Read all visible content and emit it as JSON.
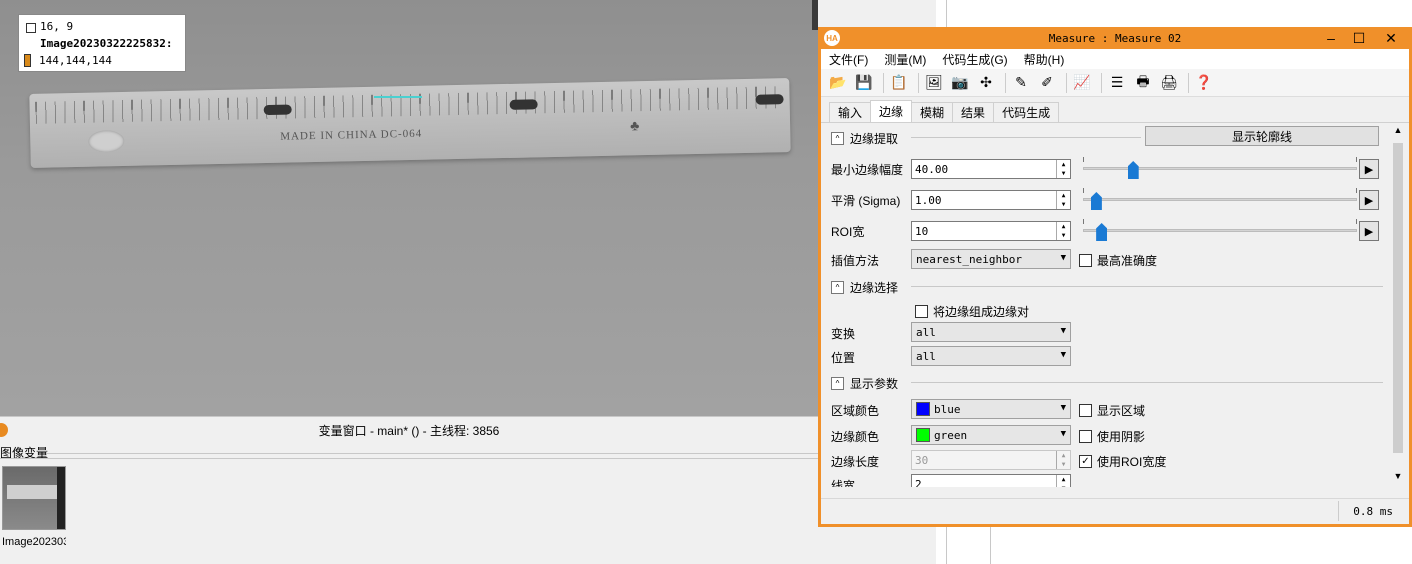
{
  "graphics": {
    "info_coords": "16, 9",
    "info_image_name": "Image20230322225832:",
    "info_gray_values": "144,144,144",
    "ruler_imprint": "MADE IN CHINA  DC-064"
  },
  "variable_window": {
    "title": "变量窗口 - main* () - 主线程: 3856",
    "group_label": "图像变量",
    "thumbnail_label": "Image202303"
  },
  "dialog": {
    "title": "Measure : Measure 02",
    "menu": [
      "文件(F)",
      "测量(M)",
      "代码生成(G)",
      "帮助(H)"
    ],
    "tabs": [
      "输入",
      "边缘",
      "模糊",
      "结果",
      "代码生成"
    ],
    "active_tab": "边缘",
    "edge_extraction": {
      "section_title": "边缘提取",
      "show_contour_button": "显示轮廓线",
      "min_amplitude_label": "最小边缘幅度",
      "min_amplitude_value": "40.00",
      "min_amplitude_slider": 0.17,
      "sigma_label": "平滑 (Sigma)",
      "sigma_value": "1.00",
      "sigma_slider": 0.03,
      "roi_width_label": "ROI宽",
      "roi_width_value": "10",
      "roi_width_slider": 0.05,
      "interpolation_label": "插值方法",
      "interpolation_value": "nearest_neighbor",
      "highest_accuracy_label": "最高准确度"
    },
    "edge_selection": {
      "section_title": "边缘选择",
      "pair_checkbox_label": "将边缘组成边缘对",
      "transition_label": "变换",
      "transition_value": "all",
      "position_label": "位置",
      "position_value": "all"
    },
    "display_params": {
      "section_title": "显示参数",
      "region_color_label": "区域颜色",
      "region_color_value": "blue",
      "region_color_hex": "#0000ff",
      "show_region_label": "显示区域",
      "edge_color_label": "边缘颜色",
      "edge_color_value": "green",
      "edge_color_hex": "#00ff00",
      "use_shadow_label": "使用阴影",
      "edge_length_label": "边缘长度",
      "edge_length_value": "30",
      "use_roi_width_label": "使用ROI宽度",
      "use_roi_width_checked": true,
      "line_width_label": "线宽",
      "line_width_value": "2"
    },
    "status_timing": "0.8 ms"
  },
  "icons": [
    "open-icon",
    "save-icon",
    "copy-icon",
    "image-icon",
    "camera-icon",
    "tool-icon",
    "pen-icon",
    "pen2-icon",
    "chart-icon",
    "list-icon",
    "print-icon",
    "print2-icon",
    "help-icon"
  ]
}
